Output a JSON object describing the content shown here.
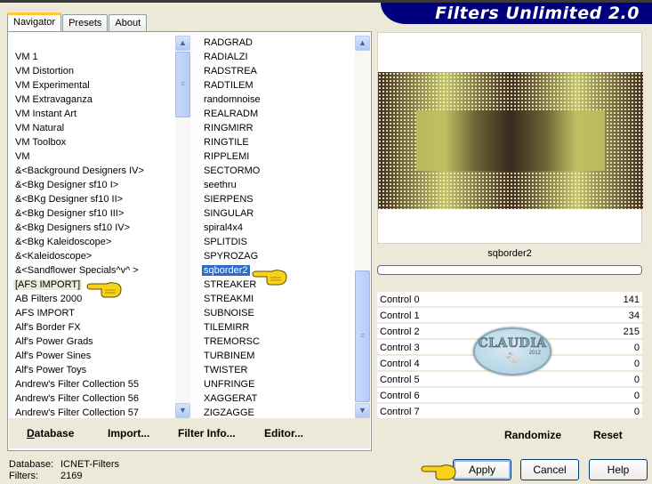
{
  "app": {
    "title": "Filters Unlimited 2.0"
  },
  "tabs": [
    {
      "label": "Navigator",
      "active": true
    },
    {
      "label": "Presets",
      "active": false
    },
    {
      "label": "About",
      "active": false
    }
  ],
  "categories": {
    "items": [
      "VM 1",
      "VM Distortion",
      "VM Experimental",
      "VM Extravaganza",
      "VM Instant Art",
      "VM Natural",
      "VM Toolbox",
      "VM",
      "&<Background Designers IV>",
      "&<Bkg Designer sf10 I>",
      "&<BKg Designer sf10 II>",
      "&<Bkg Designer sf10 III>",
      "&<Bkg Designers sf10 IV>",
      "&<Bkg Kaleidoscope>",
      "&<Kaleidoscope>",
      "&<Sandflower Specials^v^ >",
      "[AFS IMPORT]",
      "AB Filters 2000",
      "AFS IMPORT",
      "Alf's Border FX",
      "Alf's Power Grads",
      "Alf's Power Sines",
      "Alf's Power Toys",
      "Andrew's Filter Collection 55",
      "Andrew's Filter Collection 56",
      "Andrew's Filter Collection 57"
    ],
    "selected": "[AFS IMPORT]"
  },
  "filters": {
    "items": [
      "RADGRAD",
      "RADIALZI",
      "RADSTREA",
      "RADTILEM",
      "randomnoise",
      "REALRADM",
      "RINGMIRR",
      "RINGTILE",
      "RIPPLEMI",
      "SECTORMO",
      "seethru",
      "SIERPENS",
      "SINGULAR",
      "spiral4x4",
      "SPLITDIS",
      "SPYROZAG",
      "sqborder2",
      "STREAKER",
      "STREAKMI",
      "SUBNOISE",
      "TILEMIRR",
      "TREMORSC",
      "TURBINEM",
      "TWISTER",
      "UNFRINGE",
      "XAGGERAT",
      "ZIGZAGGE"
    ],
    "selected": "sqborder2"
  },
  "bottom_links": {
    "database": "Database",
    "import": "Import...",
    "filter_info": "Filter Info...",
    "editor": "Editor..."
  },
  "preview": {
    "filter_name": "sqborder2",
    "progress": 0,
    "colors": {
      "dark": "#3f2c20",
      "light": "#c4c46a",
      "dots": "#f4f1c8"
    }
  },
  "controls": [
    {
      "label": "Control 0",
      "value": "141"
    },
    {
      "label": "Control 1",
      "value": "34"
    },
    {
      "label": "Control 2",
      "value": "215"
    },
    {
      "label": "Control 3",
      "value": "0"
    },
    {
      "label": "Control 4",
      "value": "0"
    },
    {
      "label": "Control 5",
      "value": "0"
    },
    {
      "label": "Control 6",
      "value": "0"
    },
    {
      "label": "Control 7",
      "value": "0"
    }
  ],
  "right_links": {
    "randomize": "Randomize",
    "reset": "Reset"
  },
  "status": {
    "database_label": "Database:",
    "database_value": "ICNET-Filters",
    "filters_label": "Filters:",
    "filters_value": "2169"
  },
  "buttons": {
    "apply": "Apply",
    "cancel": "Cancel",
    "help": "Help"
  },
  "watermark": {
    "text": "CLAUDIA",
    "year": "2012"
  }
}
